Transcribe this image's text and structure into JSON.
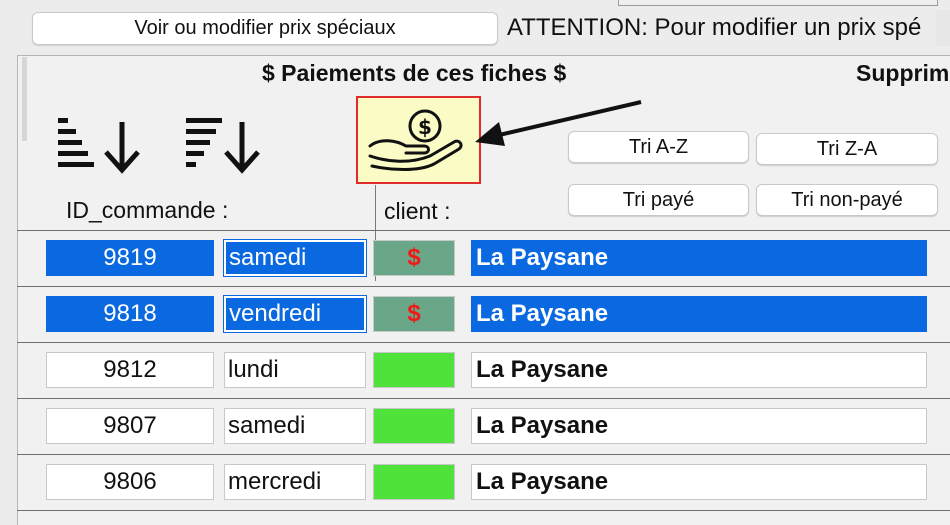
{
  "top": {
    "prices_button": "Voir ou modifier prix spéciaux",
    "attention_text": "ATTENTION: Pour modifier un prix spé"
  },
  "panel": {
    "title": "$ Paiements de ces fiches $",
    "title_right": "Supprim"
  },
  "sort_buttons": {
    "az": "Tri A-Z",
    "za": "Tri Z-A",
    "paid": "Tri payé",
    "unpaid": "Tri non-payé"
  },
  "columns": {
    "id": "ID_commande :",
    "client": "client :"
  },
  "icons": {
    "sort_ascending": "sort-ascending-icon",
    "sort_descending": "sort-descending-icon",
    "payment": "hand-coin-dollar-icon",
    "arrow": "pointer-arrow"
  },
  "colors": {
    "selection": "#0a68e0",
    "paid": "#6aa688",
    "unpaid": "#4ee23a",
    "dollar": "#f01818",
    "highlight_border": "#e02b2b",
    "highlight_fill": "#fbfbc6"
  },
  "rows": [
    {
      "id": "9819",
      "day": "samedi",
      "paid": true,
      "pay_symbol": "$",
      "client": "La Paysane",
      "selected": true
    },
    {
      "id": "9818",
      "day": "vendredi",
      "paid": true,
      "pay_symbol": "$",
      "client": "La Paysane",
      "selected": true
    },
    {
      "id": "9812",
      "day": "lundi",
      "paid": false,
      "pay_symbol": "",
      "client": "La Paysane",
      "selected": false
    },
    {
      "id": "9807",
      "day": "samedi",
      "paid": false,
      "pay_symbol": "",
      "client": "La Paysane",
      "selected": false
    },
    {
      "id": "9806",
      "day": "mercredi",
      "paid": false,
      "pay_symbol": "",
      "client": "La Paysane",
      "selected": false
    }
  ]
}
